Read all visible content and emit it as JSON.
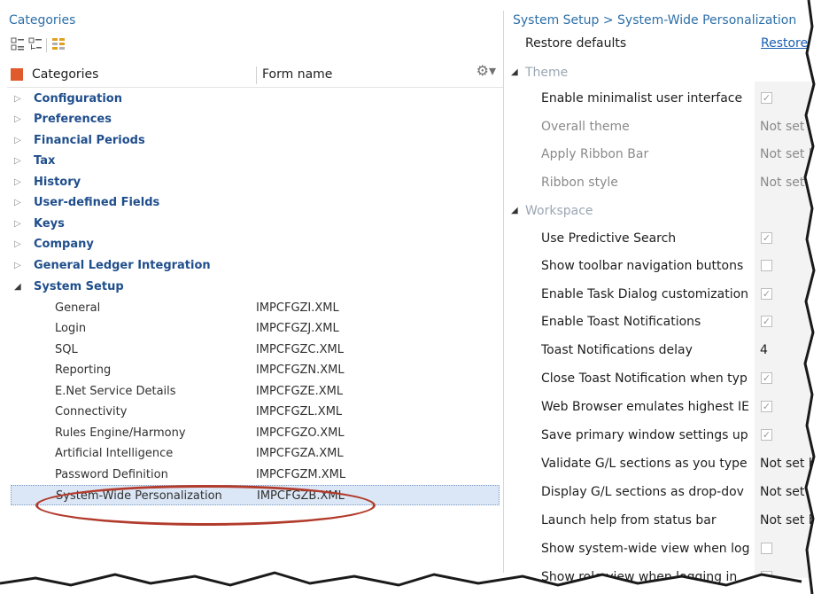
{
  "left_pane": {
    "title": "Categories",
    "columns": {
      "categories": "Categories",
      "form_name": "Form name"
    },
    "categories": [
      {
        "label": "Configuration"
      },
      {
        "label": "Preferences"
      },
      {
        "label": "Financial Periods"
      },
      {
        "label": "Tax"
      },
      {
        "label": "History"
      },
      {
        "label": "User-defined Fields"
      },
      {
        "label": "Keys"
      },
      {
        "label": "Company"
      },
      {
        "label": "General Ledger Integration"
      },
      {
        "label": "System Setup"
      }
    ],
    "system_setup_items": [
      {
        "name": "General",
        "form": "IMPCFGZI.XML"
      },
      {
        "name": "Login",
        "form": "IMPCFGZJ.XML"
      },
      {
        "name": "SQL",
        "form": "IMPCFGZC.XML"
      },
      {
        "name": "Reporting",
        "form": "IMPCFGZN.XML"
      },
      {
        "name": "E.Net Service Details",
        "form": "IMPCFGZE.XML"
      },
      {
        "name": "Connectivity",
        "form": "IMPCFGZL.XML"
      },
      {
        "name": "Rules Engine/Harmony",
        "form": "IMPCFGZO.XML"
      },
      {
        "name": "Artificial Intelligence",
        "form": "IMPCFGZA.XML"
      },
      {
        "name": "Password Definition",
        "form": "IMPCFGZM.XML"
      },
      {
        "name": "System-Wide Personalization",
        "form": "IMPCFGZB.XML"
      }
    ]
  },
  "right_pane": {
    "breadcrumb": "System Setup > System-Wide Personalization",
    "restore_defaults_label": "Restore defaults",
    "restore_link": "Restore",
    "groups": {
      "theme": "Theme",
      "workspace": "Workspace"
    },
    "theme_props": [
      {
        "label": "Enable minimalist user interface",
        "checked": true
      },
      {
        "label": "Overall theme",
        "value": "Not set b"
      },
      {
        "label": "Apply Ribbon Bar",
        "value": "Not set b"
      },
      {
        "label": "Ribbon style",
        "value": "Not set b"
      }
    ],
    "workspace_props": [
      {
        "label": "Use Predictive Search",
        "checked": true
      },
      {
        "label": "Show toolbar navigation buttons",
        "checked": false
      },
      {
        "label": "Enable Task Dialog customization",
        "checked": true
      },
      {
        "label": "Enable Toast Notifications",
        "checked": true
      },
      {
        "label": "Toast Notifications delay",
        "value": "4"
      },
      {
        "label": "Close Toast Notification when typ",
        "checked": true
      },
      {
        "label": "Web Browser emulates highest IE",
        "checked": true
      },
      {
        "label": "Save primary window settings up",
        "checked": true
      },
      {
        "label": "Validate G/L sections as you type",
        "value": "Not set b"
      },
      {
        "label": "Display G/L sections as drop-dov",
        "value": "Not set by"
      },
      {
        "label": "Launch help from status bar",
        "value": "Not set b"
      },
      {
        "label": "Show system-wide view when log",
        "checked": false
      },
      {
        "label": "Show role view when logging in",
        "checked": false
      }
    ]
  },
  "colors": {
    "accent": "#2d6fa8",
    "category_text": "#1f4e8c",
    "highlight_oval": "#b23b2c",
    "selected_row": "#dbe7f6"
  }
}
